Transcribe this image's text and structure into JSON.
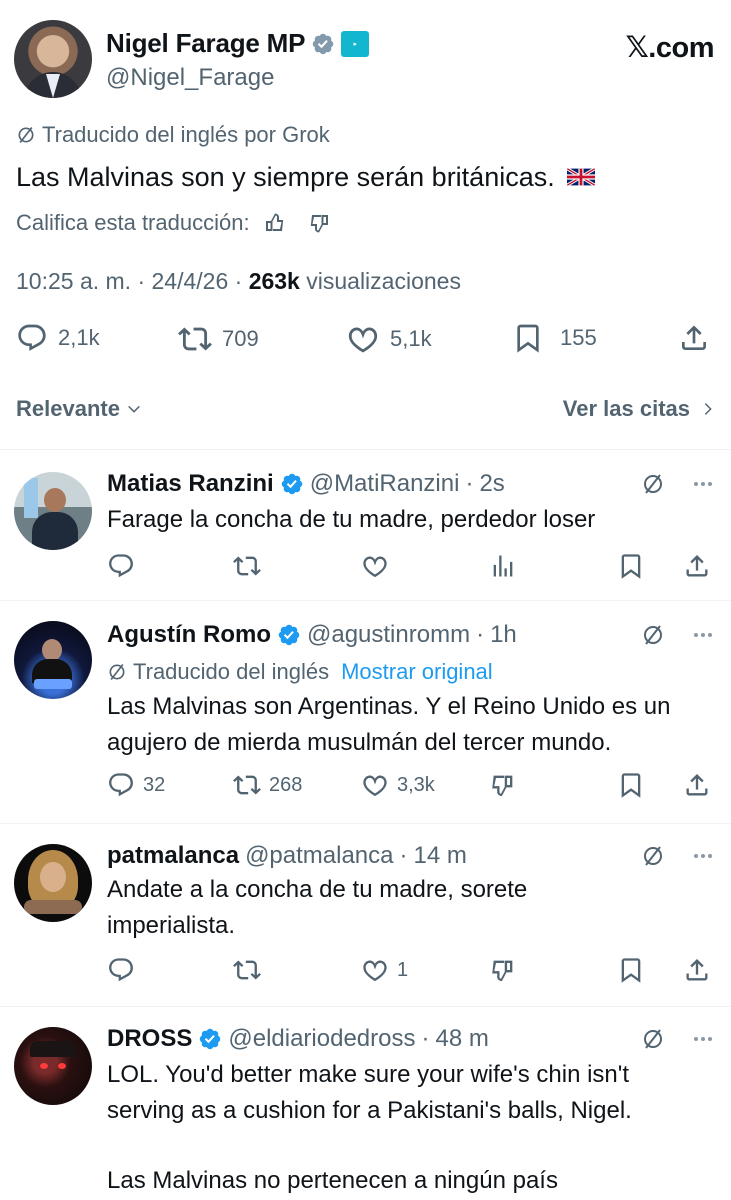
{
  "post": {
    "author_name": "Nigel Farage MP",
    "author_handle": "@Nigel_Farage",
    "watermark": "𝕏.com",
    "translated_label": "Traducido del inglés por Grok",
    "text": "Las Malvinas son y siempre serán británicas.",
    "flag_icon": "uk-flag-icon",
    "rate_label": "Califica esta traducción:",
    "time": "10:25 a. m. · 24/4/26 · ",
    "views_count": "263k",
    "views_label": " visualizaciones",
    "stats": {
      "replies": "2,1k",
      "reposts": "709",
      "likes": "5,1k",
      "bookmarks": "155"
    }
  },
  "filter": {
    "sort_label": "Relevante",
    "quotes_label": "Ver las citas"
  },
  "replies": [
    {
      "name": "Matias Ranzini",
      "handle": "@MatiRanzini",
      "sep": "·",
      "time": "2s",
      "verified": true,
      "text": "Farage la concha de tu madre, perdedor loser"
    },
    {
      "name": "Agustín Romo",
      "handle": "@agustinromm",
      "sep": "·",
      "time": "1h",
      "verified": true,
      "translated_label": "Traducido del inglés",
      "show_original": "Mostrar original",
      "text": "Las Malvinas son Argentinas. Y el Reino Unido es un agujero de mierda musulmán del tercer mundo.",
      "stats": {
        "replies": "32",
        "reposts": "268",
        "likes": "3,3k"
      }
    },
    {
      "name": "patmalanca",
      "handle": "@patmalanca",
      "sep": "·",
      "time": "14 m",
      "verified": false,
      "text": "Andate a la concha de tu madre, sorete imperialista.",
      "stats": {
        "likes": "1"
      }
    },
    {
      "name": "DROSS",
      "handle": "@eldiariodedross",
      "sep": "·",
      "time": "48 m",
      "verified": true,
      "text_line1": "LOL. You'd better make sure your wife's chin isn't serving as a cushion for a Pakistani's balls, Nigel.",
      "text_line2": "Las Malvinas no pertenecen a ningún país"
    }
  ],
  "colors": {
    "link": "#1d9bf0",
    "muted": "#536471",
    "text": "#0f1419"
  }
}
